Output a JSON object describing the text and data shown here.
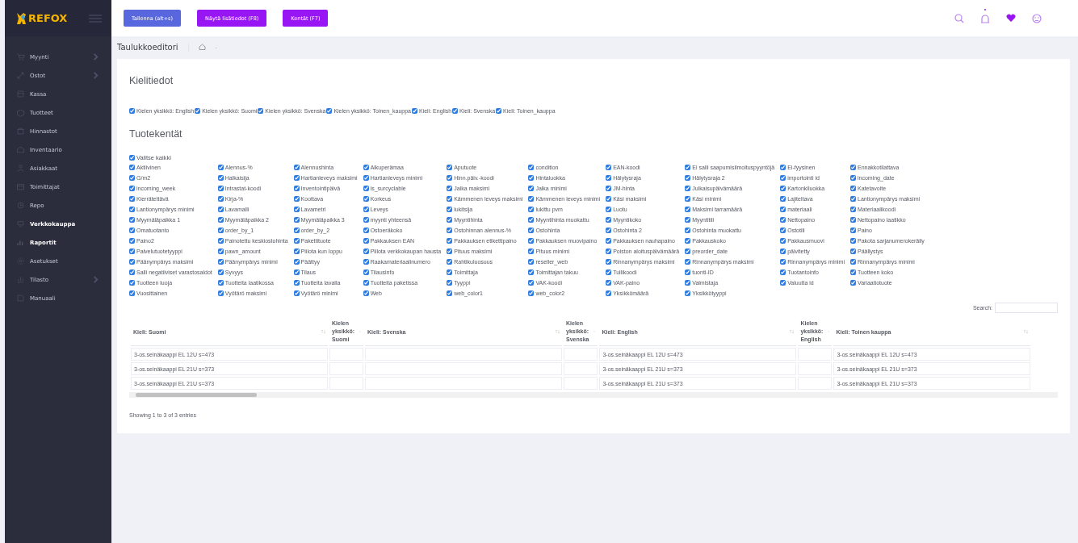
{
  "logo": {
    "text": "REFOX"
  },
  "toolbar": {
    "buttons": [
      {
        "label": "Tallenna (alt+s)",
        "kind": "primary"
      },
      {
        "label": "Näytä lisätiedot (F8)",
        "kind": "accent"
      },
      {
        "label": "Kentät (F7)",
        "kind": "accent"
      }
    ],
    "notification_dot": true
  },
  "sidebar": {
    "items": [
      {
        "label": "Myynti",
        "has_submenu": true,
        "active": false
      },
      {
        "label": "Ostot",
        "has_submenu": true,
        "active": false
      },
      {
        "label": "Kassa",
        "has_submenu": false,
        "active": false
      },
      {
        "label": "Tuotteet",
        "has_submenu": false,
        "active": false
      },
      {
        "label": "Hinnastot",
        "has_submenu": false,
        "active": false
      },
      {
        "label": "Inventaario",
        "has_submenu": false,
        "active": false
      },
      {
        "label": "Asiakkaat",
        "has_submenu": false,
        "active": false
      },
      {
        "label": "Toimittajat",
        "has_submenu": false,
        "active": false
      },
      {
        "label": "Repo",
        "has_submenu": false,
        "active": false
      },
      {
        "label": "Verkkokauppa",
        "has_submenu": false,
        "active": true
      },
      {
        "label": "Raportit",
        "has_submenu": false,
        "active": true
      },
      {
        "label": "Asetukset",
        "has_submenu": false,
        "active": false
      },
      {
        "label": "Tilasto",
        "has_submenu": true,
        "active": false
      },
      {
        "label": "Manuaali",
        "has_submenu": false,
        "active": false
      }
    ]
  },
  "page_title": "Taulukkoeditori",
  "breadcrumb": {
    "separator": "-"
  },
  "language_section": {
    "title": "Kielitiedot",
    "options": [
      {
        "label": "Kielen yksikkö: English",
        "checked": true
      },
      {
        "label": "Kielen yksikkö: Suomi",
        "checked": true
      },
      {
        "label": "Kielen yksikkö: Svenska",
        "checked": true
      },
      {
        "label": "Kielen yksikkö: Toinen_kauppa",
        "checked": true
      },
      {
        "label": "Kieli: English",
        "checked": true
      },
      {
        "label": "Kieli: Svenska",
        "checked": true
      },
      {
        "label": "Kieli: Toinen_kauppa",
        "checked": true
      }
    ]
  },
  "fields_section": {
    "title": "Tuotekentät",
    "select_all": {
      "label": "Valitse kaikki",
      "checked": true
    },
    "fields": [
      {
        "label": "Aktiivinen",
        "checked": true
      },
      {
        "label": "Alennus-%",
        "checked": true
      },
      {
        "label": "Alennushinta",
        "checked": true
      },
      {
        "label": "Alkuperämaa",
        "checked": true
      },
      {
        "label": "Aputuote",
        "checked": true
      },
      {
        "label": "condition",
        "checked": true
      },
      {
        "label": "EAN-koodi",
        "checked": true
      },
      {
        "label": "Ei salli saapumisilmoituspyyntöjä",
        "checked": true
      },
      {
        "label": "Ei-fyysinen",
        "checked": true
      },
      {
        "label": "Ennakkotilattava",
        "checked": true
      },
      {
        "label": "G/m2",
        "checked": true
      },
      {
        "label": "Halkaisija",
        "checked": true
      },
      {
        "label": "Hartianleveys maksimi",
        "checked": true
      },
      {
        "label": "Hartianleveys minimi",
        "checked": true
      },
      {
        "label": "Hinn.päiv.-koodi",
        "checked": true
      },
      {
        "label": "Hintaluokka",
        "checked": true
      },
      {
        "label": "Hälytysraja",
        "checked": true
      },
      {
        "label": "Hälytysraja 2",
        "checked": true
      },
      {
        "label": "importointi id",
        "checked": true
      },
      {
        "label": "incoming_date",
        "checked": true
      },
      {
        "label": "incoming_week",
        "checked": true
      },
      {
        "label": "Intrastat-koodi",
        "checked": true
      },
      {
        "label": "Inventointipäivä",
        "checked": true
      },
      {
        "label": "is_surcyclable",
        "checked": true
      },
      {
        "label": "Jalka maksimi",
        "checked": true
      },
      {
        "label": "Jalka minimi",
        "checked": true
      },
      {
        "label": "JM-hinta",
        "checked": true
      },
      {
        "label": "Julkaisupäivämäärä",
        "checked": true
      },
      {
        "label": "Kartonkiluokka",
        "checked": true
      },
      {
        "label": "Katetavoite",
        "checked": true
      },
      {
        "label": "Kierrätettävä",
        "checked": true
      },
      {
        "label": "Kirja-%",
        "checked": true
      },
      {
        "label": "Koottava",
        "checked": true
      },
      {
        "label": "Korkeus",
        "checked": true
      },
      {
        "label": "Kämmenen leveys maksimi",
        "checked": true
      },
      {
        "label": "Kämmenen leveys minimi",
        "checked": true
      },
      {
        "label": "Käsi maksimi",
        "checked": true
      },
      {
        "label": "Käsi minimi",
        "checked": true
      },
      {
        "label": "Lajiteltava",
        "checked": true
      },
      {
        "label": "Lantionympärys maksimi",
        "checked": true
      },
      {
        "label": "Lantionympärys minimi",
        "checked": true
      },
      {
        "label": "Lavamalli",
        "checked": true
      },
      {
        "label": "Lavametri",
        "checked": true
      },
      {
        "label": "Leveys",
        "checked": true
      },
      {
        "label": "lukitsija",
        "checked": true
      },
      {
        "label": "lukittu pvm",
        "checked": true
      },
      {
        "label": "Luotu",
        "checked": true
      },
      {
        "label": "Maksimi tarramäärä",
        "checked": true
      },
      {
        "label": "materiaali",
        "checked": true
      },
      {
        "label": "Materiaalikoodi",
        "checked": true
      },
      {
        "label": "Myymäläpaikka 1",
        "checked": true
      },
      {
        "label": "Myymäläpaikka 2",
        "checked": true
      },
      {
        "label": "Myymäläpaikka 3",
        "checked": true
      },
      {
        "label": "myynti yhteensä",
        "checked": true
      },
      {
        "label": "Myyntihinta",
        "checked": true
      },
      {
        "label": "Myyntihinta muokattu",
        "checked": true
      },
      {
        "label": "Myyntikoko",
        "checked": true
      },
      {
        "label": "Myyntitili",
        "checked": true
      },
      {
        "label": "Nettopaino",
        "checked": true
      },
      {
        "label": "Nettopaino laatikko",
        "checked": true
      },
      {
        "label": "Omatuotanto",
        "checked": true
      },
      {
        "label": "order_by_1",
        "checked": true
      },
      {
        "label": "order_by_2",
        "checked": true
      },
      {
        "label": "Ostoeräkoko",
        "checked": true
      },
      {
        "label": "Ostohinnan alennus-%",
        "checked": true
      },
      {
        "label": "Ostohinta",
        "checked": true
      },
      {
        "label": "Ostohinta 2",
        "checked": true
      },
      {
        "label": "Ostohinta muokattu",
        "checked": true
      },
      {
        "label": "Ostotili",
        "checked": true
      },
      {
        "label": "Paino",
        "checked": true
      },
      {
        "label": "Paino2",
        "checked": true
      },
      {
        "label": "Painotettu keskiostohinta",
        "checked": true
      },
      {
        "label": "Pakettituote",
        "checked": true
      },
      {
        "label": "Pakkauksen EAN",
        "checked": true
      },
      {
        "label": "Pakkauksen etikettipaino",
        "checked": true
      },
      {
        "label": "Pakkauksen muovipaino",
        "checked": true
      },
      {
        "label": "Pakkauksen nauhapaino",
        "checked": true
      },
      {
        "label": "Pakkauskoko",
        "checked": true
      },
      {
        "label": "Pakkausmuovi",
        "checked": true
      },
      {
        "label": "Pakota sarjanumerokeräily",
        "checked": true
      },
      {
        "label": "Palvelutuotetyyppi",
        "checked": true
      },
      {
        "label": "pawn_amount",
        "checked": true
      },
      {
        "label": "Piilota kun loppu",
        "checked": true
      },
      {
        "label": "Piilota verkkokaupan hausta",
        "checked": true
      },
      {
        "label": "Pituus maksimi",
        "checked": true
      },
      {
        "label": "Pituus minimi",
        "checked": true
      },
      {
        "label": "Poiston aloituspäivämäärä",
        "checked": true
      },
      {
        "label": "preorder_date",
        "checked": true
      },
      {
        "label": "päivitetty",
        "checked": true
      },
      {
        "label": "Päällystys",
        "checked": true
      },
      {
        "label": "Päänympärys maksimi",
        "checked": true
      },
      {
        "label": "Päänympärys minimi",
        "checked": true
      },
      {
        "label": "Päättyy",
        "checked": true
      },
      {
        "label": "Raakamateriaalinumero",
        "checked": true
      },
      {
        "label": "Rahtikuluosuus",
        "checked": true
      },
      {
        "label": "reseller_web",
        "checked": true
      },
      {
        "label": "Rinnanympärys maksimi",
        "checked": true
      },
      {
        "label": "Rinnanympärys maksimi",
        "checked": true
      },
      {
        "label": "Rinnanympärys minimi",
        "checked": true
      },
      {
        "label": "Rinnanympärys minimi",
        "checked": true
      },
      {
        "label": "Salli negatiiviset varastosaldot",
        "checked": true
      },
      {
        "label": "Syvyys",
        "checked": true
      },
      {
        "label": "Tilaus",
        "checked": true
      },
      {
        "label": "Tilausinfo",
        "checked": true
      },
      {
        "label": "Toimittaja",
        "checked": true
      },
      {
        "label": "Toimittajan takuu",
        "checked": true
      },
      {
        "label": "Tullikoodi",
        "checked": true
      },
      {
        "label": "tuonti-ID",
        "checked": true
      },
      {
        "label": "Tuotantoinfo",
        "checked": true
      },
      {
        "label": "Tuotteen koko",
        "checked": true
      },
      {
        "label": "Tuotteen luoja",
        "checked": true
      },
      {
        "label": "Tuotteita laatikossa",
        "checked": true
      },
      {
        "label": "Tuotteita lavalla",
        "checked": true
      },
      {
        "label": "Tuotteita paketissa",
        "checked": true
      },
      {
        "label": "Tyyppi",
        "checked": true
      },
      {
        "label": "VAK-koodi",
        "checked": true
      },
      {
        "label": "VAK-paino",
        "checked": true
      },
      {
        "label": "Valmistaja",
        "checked": true
      },
      {
        "label": "Valuutta id",
        "checked": true
      },
      {
        "label": "Variaatiotuote",
        "checked": true
      },
      {
        "label": "Vuosittainen",
        "checked": true
      },
      {
        "label": "Vyötärö maksimi",
        "checked": true
      },
      {
        "label": "Vyötärö minimi",
        "checked": true
      },
      {
        "label": "Web",
        "checked": true
      },
      {
        "label": "web_color1",
        "checked": true
      },
      {
        "label": "web_color2",
        "checked": true
      },
      {
        "label": "Yksikkömäärä",
        "checked": true
      },
      {
        "label": "Yksikkötyyppi",
        "checked": true
      }
    ]
  },
  "table": {
    "search_label": "Search:",
    "columns": [
      {
        "label": "Kieli: Suomi",
        "kind": "text"
      },
      {
        "label": "Kielen yksikkö: Suomi",
        "kind": "unit"
      },
      {
        "label": "Kieli: Svenska",
        "kind": "text"
      },
      {
        "label": "Kielen yksikkö: Svenska",
        "kind": "unit"
      },
      {
        "label": "Kieli: English",
        "kind": "text"
      },
      {
        "label": "Kielen yksikkö: English",
        "kind": "unit"
      },
      {
        "label": "Kieli: Toinen kauppa",
        "kind": "text"
      }
    ],
    "rows": [
      [
        "3-os.seinäkaappi EL 12U s=473",
        null,
        null,
        null,
        "3-os.seinäkaappi EL 12U s=473",
        null,
        "3-os.seinäkaappi EL 12U s=473"
      ],
      [
        "3-os.seinäkaappi EL 21U s=373",
        null,
        null,
        null,
        "3-os.seinäkaappi EL 21U s=373",
        null,
        "3-os.seinäkaappi EL 21U s=373"
      ],
      [
        "3-os.seinäkaappi EL 21U s=373",
        null,
        null,
        null,
        "3-os.seinäkaappi EL 21U s=373",
        null,
        "3-os.seinäkaappi EL 21U s=373"
      ]
    ],
    "info": "Showing 1 to 3 of 3 entries"
  }
}
